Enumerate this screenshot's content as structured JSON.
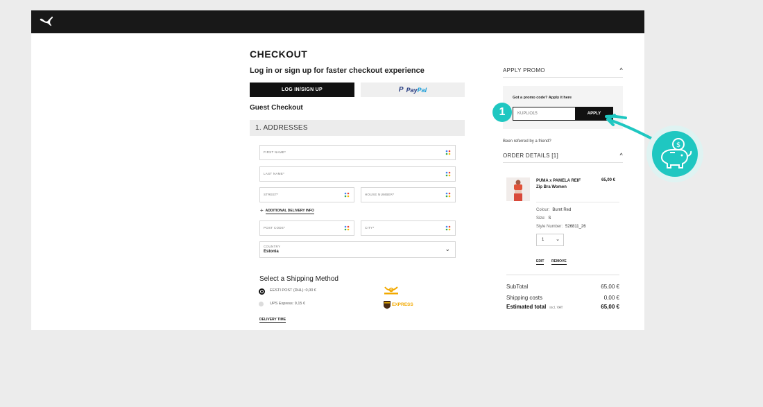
{
  "header": {
    "logo": "puma-logo-icon"
  },
  "checkout": {
    "title": "CHECKOUT",
    "login_prompt": "Log in or sign up for faster checkout experience",
    "login_button": "LOG IN/SIGN UP",
    "paypal_button": {
      "part1": "Pay",
      "part2": "Pal"
    },
    "guest_title": "Guest Checkout",
    "section_addresses": "1. ADDRESSES",
    "fields": {
      "first_name": "FIRST NAME*",
      "last_name": "LAST NAME*",
      "street": "STREET*",
      "house_number": "HOUSE NUMBER*",
      "post_code": "POST CODE*",
      "city": "CITY*",
      "country_label": "COUNTRY",
      "country_value": "Estonia"
    },
    "additional_info": "ADDITIONAL DELIVERY INFO",
    "shipping": {
      "title": "Select a Shipping Method",
      "options": [
        {
          "label": "EESTI POST (DHL): 0,00 €",
          "selected": true,
          "logo": "eesti-post-logo-icon"
        },
        {
          "label": "UPS Express: 9,15 €",
          "selected": false,
          "logo": "ups-express-logo-icon",
          "logo_text": "EXPRESS"
        }
      ],
      "delivery_time": "DELIVERY TIME"
    }
  },
  "promo": {
    "heading": "APPLY PROMO",
    "question": "Got a promo code? Apply it here",
    "code_value": "KUPLIO15",
    "apply_button": "APPLY",
    "referred": "Been referred by a friend?"
  },
  "order": {
    "heading": "ORDER DETAILS [1]",
    "item": {
      "name": "PUMA x PAMELA REIF Zip Bra Women",
      "price": "65,00 €",
      "colour_label": "Colour:",
      "colour": "Burnt Red",
      "size_label": "Size:",
      "size": "S",
      "style_label": "Style Number:",
      "style": "526811_26",
      "quantity": "1",
      "edit": "EDIT",
      "remove": "REMOVE"
    },
    "summary": {
      "subtotal_label": "SubTotal",
      "subtotal": "65,00 €",
      "shipping_label": "Shipping costs",
      "shipping": "0,00 €",
      "total_label": "Estimated total",
      "vat_note": "incl. VAT",
      "total": "65,00 €"
    }
  },
  "overlay": {
    "step_number": "1",
    "accent_color": "#1fc7c1",
    "badge_icon": "piggy-bank-icon"
  }
}
